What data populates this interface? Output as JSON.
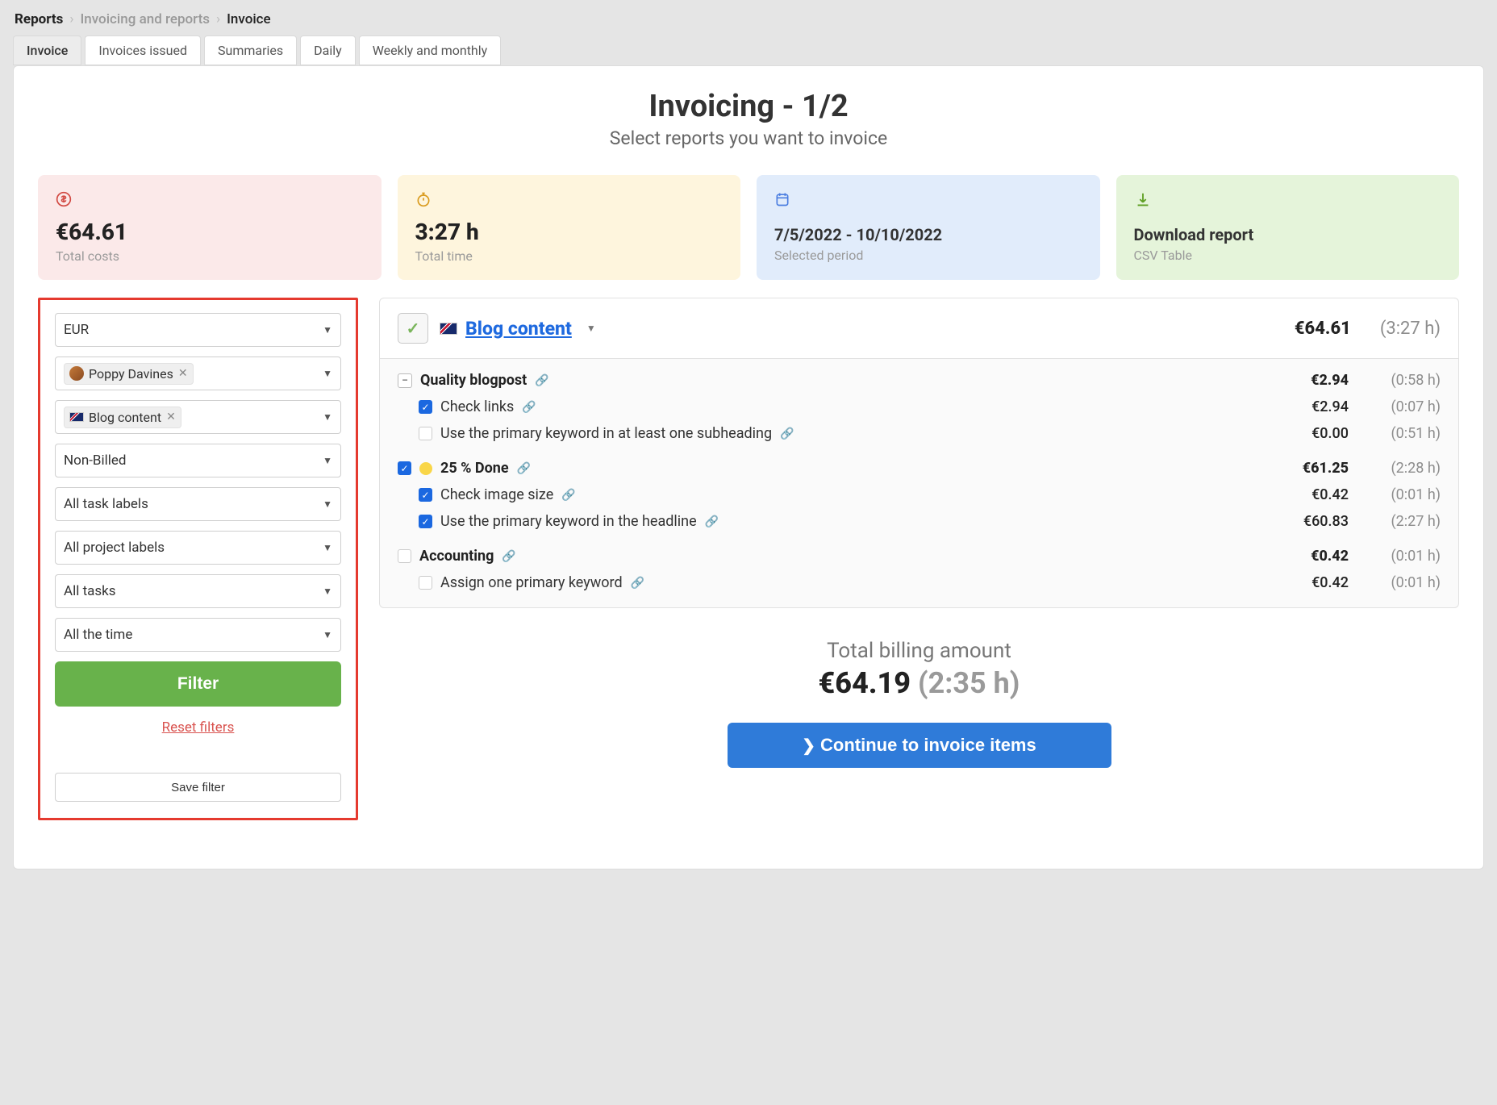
{
  "breadcrumbs": {
    "root": "Reports",
    "mid": "Invoicing and reports",
    "last": "Invoice"
  },
  "tabs": {
    "invoice": "Invoice",
    "issued": "Invoices issued",
    "summaries": "Summaries",
    "daily": "Daily",
    "weekly": "Weekly and monthly"
  },
  "header": {
    "title": "Invoicing - 1/2",
    "subtitle": "Select reports you want to invoice"
  },
  "stats": {
    "costs": {
      "value": "€64.61",
      "label": "Total costs"
    },
    "time": {
      "value": "3:27 h",
      "label": "Total time"
    },
    "period": {
      "value": "7/5/2022 - 10/10/2022",
      "label": "Selected period"
    },
    "download": {
      "value": "Download report",
      "label": "CSV Table"
    }
  },
  "filters": {
    "currency": "EUR",
    "user_chip": "Poppy Davines",
    "project_chip": "Blog content",
    "billed": "Non-Billed",
    "task_labels": "All task labels",
    "project_labels": "All project labels",
    "tasks": "All tasks",
    "timeframe": "All the time",
    "filter_btn": "Filter",
    "reset_link": "Reset filters",
    "save_btn": "Save filter"
  },
  "project": {
    "name": "Blog content",
    "price": "€64.61",
    "time": "(3:27 h)"
  },
  "rows": {
    "g1": {
      "name": "Quality blogpost",
      "price": "€2.94",
      "time": "(0:58 h)"
    },
    "g1a": {
      "name": "Check links",
      "price": "€2.94",
      "time": "(0:07 h)"
    },
    "g1b": {
      "name": "Use the primary keyword in at least one subheading",
      "price": "€0.00",
      "time": "(0:51 h)"
    },
    "g2": {
      "name": "25 % Done",
      "price": "€61.25",
      "time": "(2:28 h)"
    },
    "g2a": {
      "name": "Check image size",
      "price": "€0.42",
      "time": "(0:01 h)"
    },
    "g2b": {
      "name": "Use the primary keyword in the headline",
      "price": "€60.83",
      "time": "(2:27 h)"
    },
    "g3": {
      "name": "Accounting",
      "price": "€0.42",
      "time": "(0:01 h)"
    },
    "g3a": {
      "name": "Assign one primary keyword",
      "price": "€0.42",
      "time": "(0:01 h)"
    }
  },
  "totals": {
    "label": "Total billing amount",
    "amount": "€64.19",
    "time": "(2:35 h)",
    "continue": "Continue to invoice items"
  }
}
